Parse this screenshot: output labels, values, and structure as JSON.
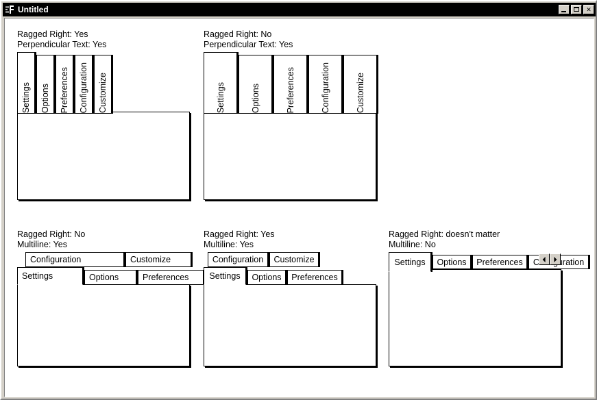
{
  "window": {
    "title": "Untitled",
    "icon": "app-icon",
    "buttons": {
      "minimize": "minimize",
      "maximize": "maximize",
      "close": "✕"
    }
  },
  "colors": {
    "titlebar_bg": "#000000",
    "titlebar_fg": "#ffffff",
    "face": "#d4d0c8",
    "client_bg": "#ffffff",
    "border": "#000000"
  },
  "demos": [
    {
      "id": "perp-ragged",
      "line1": "Ragged Right: Yes",
      "line2": "Perpendicular Text:  Yes",
      "orientation": "vertical",
      "selected_index": 0,
      "tabs": [
        {
          "label": "Settings"
        },
        {
          "label": "Options"
        },
        {
          "label": "Preferences"
        },
        {
          "label": "Configuration"
        },
        {
          "label": "Customize"
        }
      ]
    },
    {
      "id": "perp-justified",
      "line1": "Ragged Right: No",
      "line2": "Perpendicular Text:  Yes",
      "orientation": "vertical",
      "selected_index": 0,
      "tabs": [
        {
          "label": "Settings"
        },
        {
          "label": "Options"
        },
        {
          "label": "Preferences"
        },
        {
          "label": "Configuration"
        },
        {
          "label": "Customize"
        }
      ]
    },
    {
      "id": "multiline-justified",
      "line1": "Ragged Right: No",
      "line2": "Multiline: Yes",
      "orientation": "horizontal",
      "multiline": true,
      "selected_index": 0,
      "rows": [
        [
          {
            "label": "Configuration"
          },
          {
            "label": "Customize"
          }
        ],
        [
          {
            "label": "Settings"
          },
          {
            "label": "Options"
          },
          {
            "label": "Preferences"
          }
        ]
      ]
    },
    {
      "id": "multiline-ragged",
      "line1": "Ragged Right: Yes",
      "line2": "Multiline: Yes",
      "orientation": "horizontal",
      "multiline": true,
      "selected_index": 0,
      "rows": [
        [
          {
            "label": "Configuration"
          },
          {
            "label": "Customize"
          }
        ],
        [
          {
            "label": "Settings"
          },
          {
            "label": "Options"
          },
          {
            "label": "Preferences"
          }
        ]
      ]
    },
    {
      "id": "singleline-scroll",
      "line1": "Ragged Right: doesn't matter",
      "line2": "Multiline: No",
      "orientation": "horizontal",
      "multiline": false,
      "selected_index": 0,
      "scroller": {
        "prev": "scroll-left",
        "next": "scroll-right"
      },
      "tabs": [
        {
          "label": "Settings"
        },
        {
          "label": "Options"
        },
        {
          "label": "Preferences"
        },
        {
          "label": "Configuration"
        }
      ]
    }
  ]
}
